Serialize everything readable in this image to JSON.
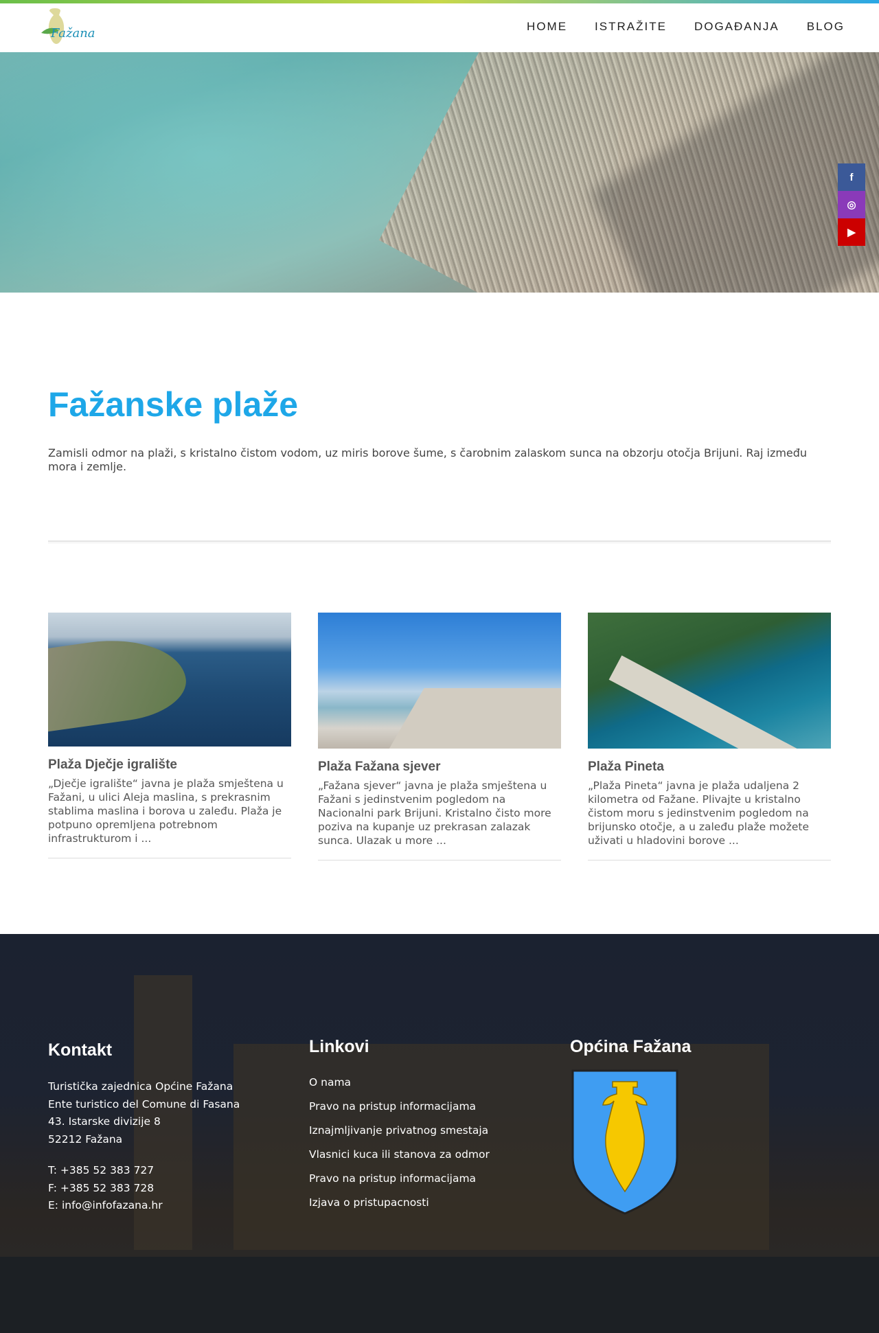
{
  "header": {
    "logo_text": "Fažana",
    "nav": [
      "HOME",
      "ISTRAŽITE",
      "DOGAĐANJA",
      "BLOG"
    ]
  },
  "social": {
    "facebook": "f",
    "instagram": "◎",
    "youtube": "▶"
  },
  "main": {
    "title": "Fažanske plaže",
    "intro": "Zamisli odmor na plaži, s kristalno čistom vodom, uz miris borove šume, s čarobnim zalaskom sunca na obzorju otočja Brijuni. Raj između mora i zemlje."
  },
  "cards": [
    {
      "title": "Plaža Dječje igralište",
      "text": "„Dječje igralište“ javna je plaža smještena u Fažani, u ulici Aleja maslina, s prekrasnim stablima maslina i borova u zaleđu. Plaža je potpuno opremljena potrebnom infrastrukturom i ..."
    },
    {
      "title": "Plaža Fažana sjever",
      "text": "„Fažana sjever“ javna je plaža smještena u Fažani s jedinstvenim pogledom na Nacionalni park Brijuni. Kristalno čisto more poziva na kupanje uz prekrasan zalazak sunca. Ulazak u more ..."
    },
    {
      "title": "Plaža Pineta",
      "text": "„Plaža Pineta“ javna je plaža udaljena 2 kilometra od Fažane. Plivajte u kristalno čistom moru s jedinstvenim pogledom na brijunsko otočje, a u zaleđu plaže možete uživati u hladovini borove ..."
    }
  ],
  "footer": {
    "kontakt": {
      "title": "Kontakt",
      "lines": [
        "Turistička zajednica Općine Fažana",
        "Ente turistico del Comune di Fasana",
        "43. Istarske divizije 8",
        "52212 Fažana"
      ],
      "phone": "T: +385 52 383 727",
      "fax": "F: +385 52 383 728",
      "email": "E: info@infofazana.hr"
    },
    "linkovi": {
      "title": "Linkovi",
      "items": [
        "O nama",
        "Pravo na pristup informacijama",
        "Iznajmljivanje privatnog smestaja",
        "Vlasnici kuca ili stanova za odmor",
        "Pravo na pristup informacijama",
        "Izjava o pristupacnosti"
      ]
    },
    "opcina": {
      "title": "Općina Fažana"
    }
  }
}
